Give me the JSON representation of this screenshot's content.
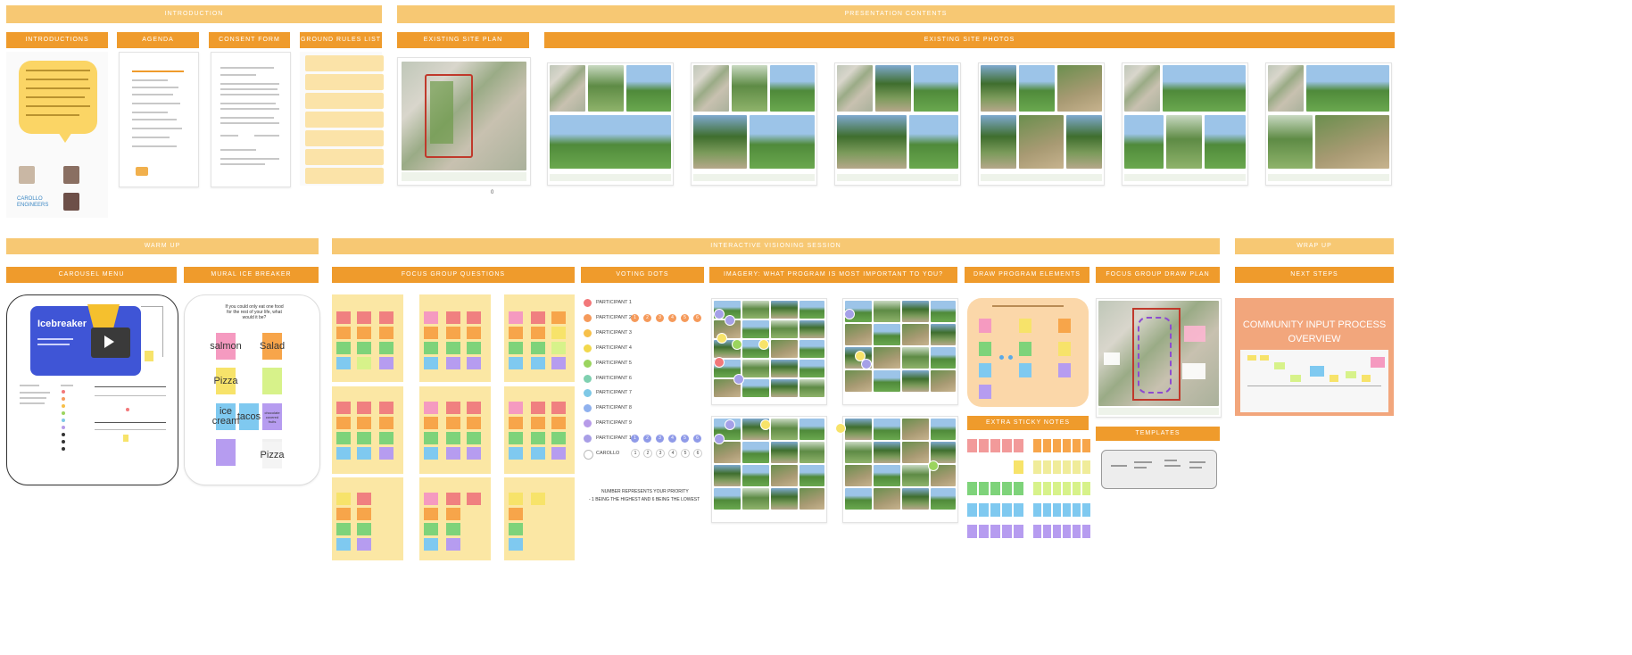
{
  "bands": {
    "introduction": "Introduction",
    "presentation_contents": "Presentation Contents",
    "warm_up": "Warm Up",
    "interactive_visioning": "Interactive Visioning Session",
    "wrap_up": "Wrap Up"
  },
  "headers": {
    "introductions": "Introductions",
    "agenda": "Agenda",
    "consent_form": "Consent Form",
    "ground_rules": "Ground Rules List",
    "existing_site_plan": "Existing Site Plan",
    "existing_site_photos": "Existing Site Photos",
    "carousel_menu": "Carousel Menu",
    "mural_ice_breaker": "Mural Ice Breaker",
    "focus_group_questions": "Focus Group Questions",
    "voting_dots": "Voting Dots",
    "imagery": "Imagery: What Program is Most Important to You?",
    "draw_program_elements": "Draw Program Elements",
    "focus_group_draw_plan": "Focus Group Draw Plan",
    "next_steps": "Next Steps",
    "extra_sticky_notes": "Extra Sticky Notes",
    "templates": "Templates"
  },
  "intro_logo": "CAROLLO ENGINEERS",
  "site_plan_page": "0",
  "icebreaker": {
    "title": "Icebreaker",
    "question": "If you could only eat one food for the rest of your life, what would it be?",
    "stickies": [
      "salmon",
      "Salad",
      "Pizza",
      "",
      "ice cream",
      "tacos",
      "chocolate covered fruits",
      "",
      "",
      "Pizza"
    ]
  },
  "voting": {
    "participants": [
      "PARTICIPANT 1",
      "PARTICIPANT 2",
      "PARTICIPANT 3",
      "PARTICIPANT 4",
      "PARTICIPANT 5",
      "PARTICIPANT 6",
      "PARTICIPANT 7",
      "PARTICIPANT 8",
      "PARTICIPANT 9",
      "PARTICIPANT 10",
      "CAROLLO"
    ],
    "colors": [
      "#f2787a",
      "#f59a5b",
      "#f7c04a",
      "#f2d84c",
      "#9bd45e",
      "#7fd0b0",
      "#7ec8e6",
      "#8fb1ee",
      "#b79be8",
      "#a89ee6",
      "#ffffff"
    ],
    "numbers": [
      "1",
      "2",
      "3",
      "4",
      "5",
      "6"
    ],
    "note_line1": "NUMBER REPRESENTS YOUR PRIORITY",
    "note_line2": "- 1 BEING THE HIGHEST AND 6 BEING THE LOWEST"
  },
  "next_steps": {
    "title_line1": "COMMUNITY INPUT PROCESS",
    "title_line2": "OVERVIEW"
  }
}
